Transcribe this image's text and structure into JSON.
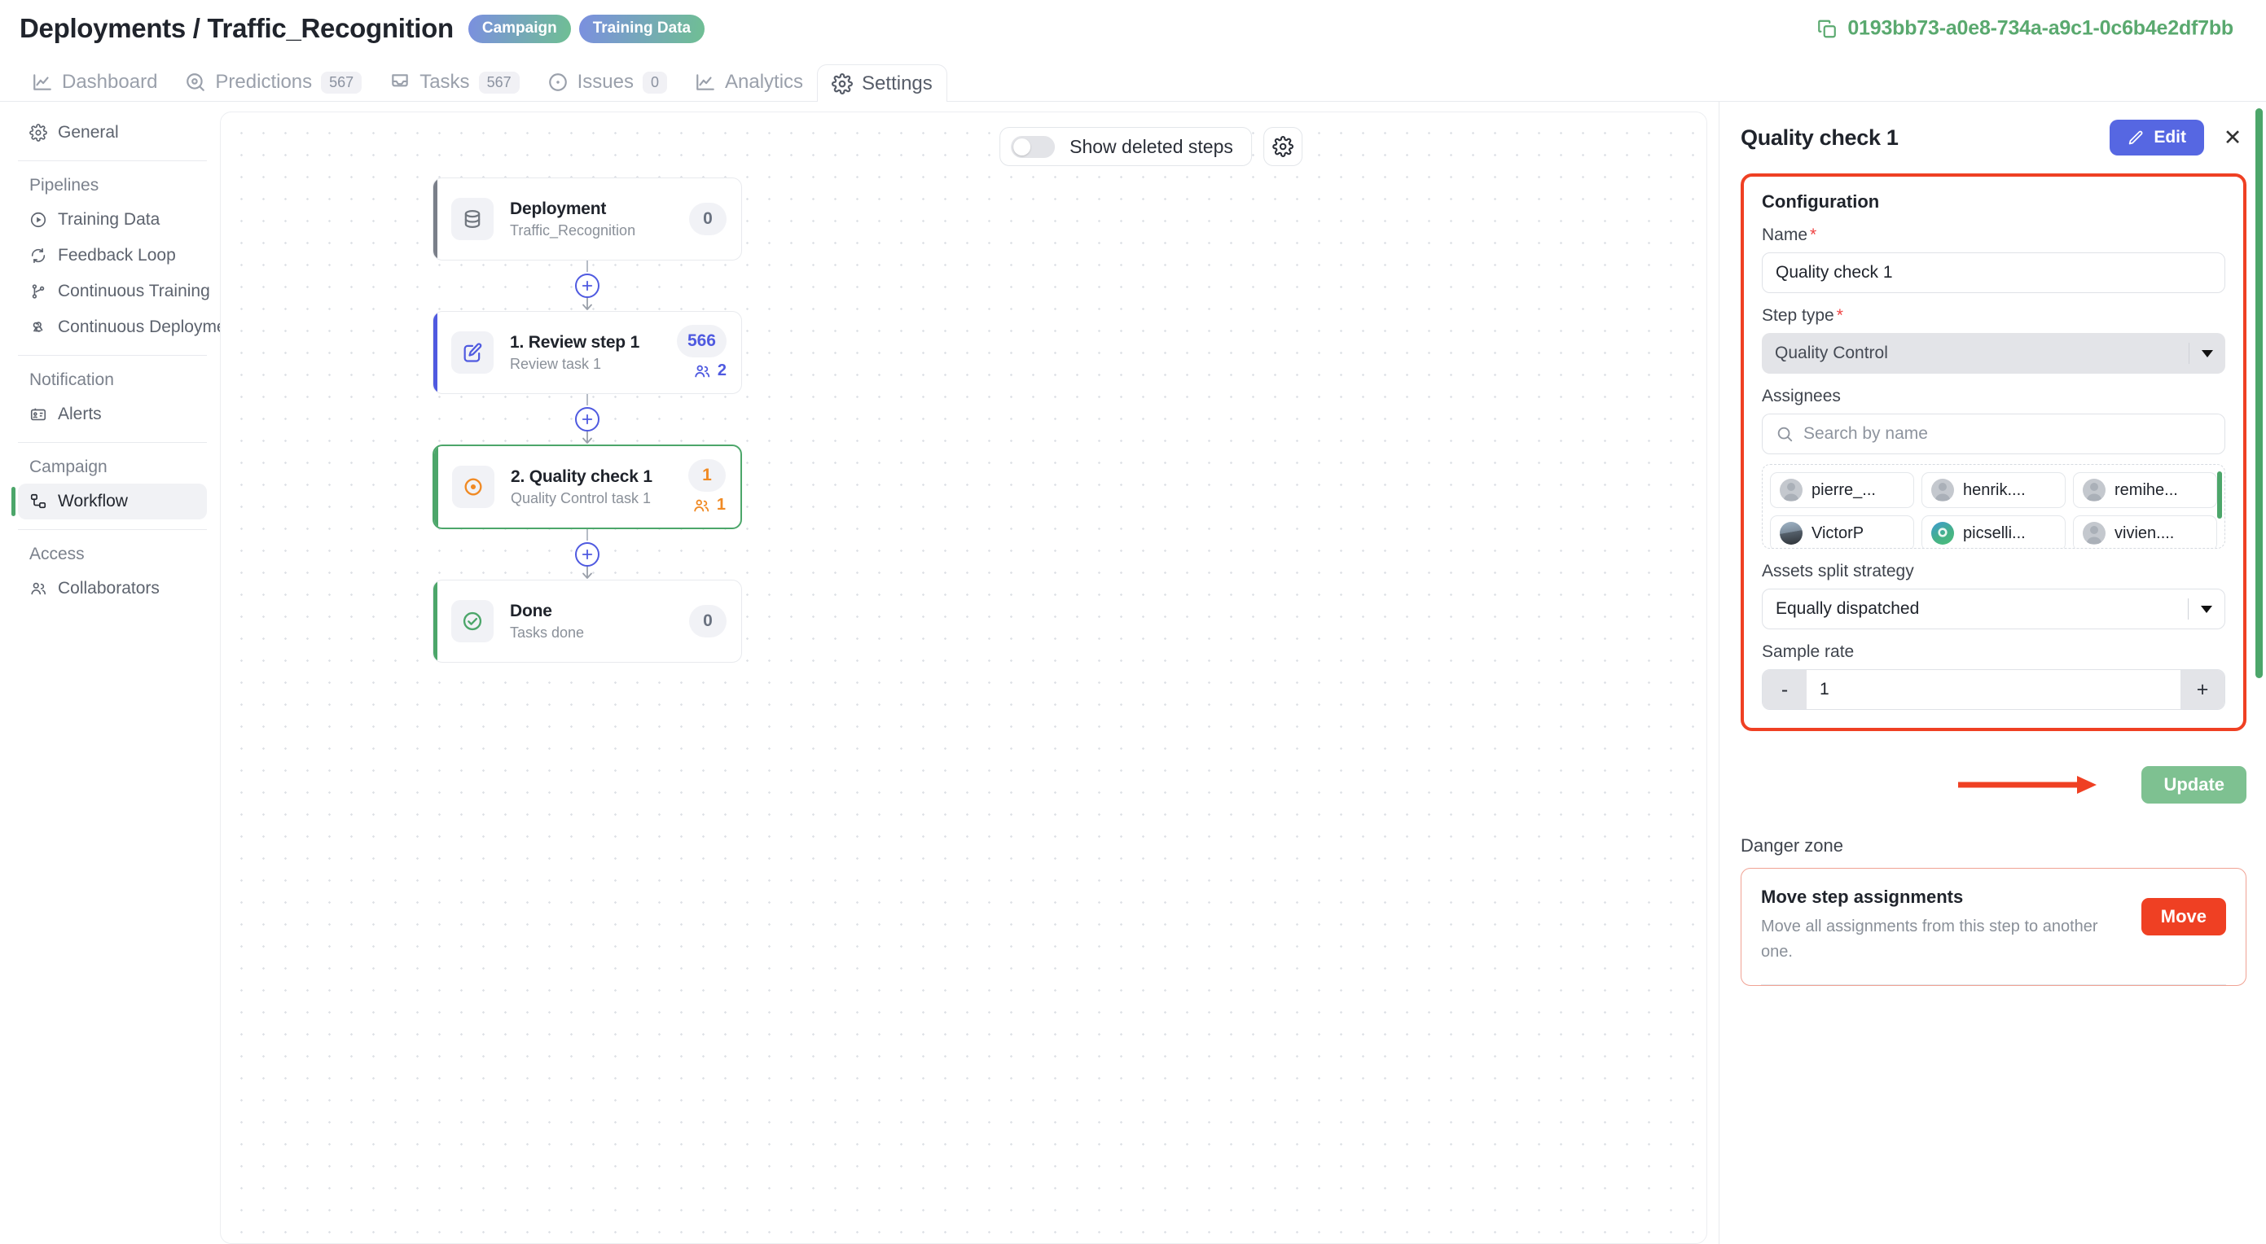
{
  "header": {
    "breadcrumb": "Deployments / Traffic_Recognition",
    "badges": [
      "Campaign",
      "Training Data"
    ],
    "deployment_id": "0193bb73-a0e8-734a-a9c1-0c6b4e2df7bb",
    "copy_icon": "copy-icon"
  },
  "tabs": [
    {
      "label": "Dashboard",
      "icon": "chart-line-icon",
      "count": null,
      "active": false
    },
    {
      "label": "Predictions",
      "icon": "target-icon",
      "count": "567",
      "active": false
    },
    {
      "label": "Tasks",
      "icon": "inbox-icon",
      "count": "567",
      "active": false
    },
    {
      "label": "Issues",
      "icon": "alert-circle-icon",
      "count": "0",
      "active": false
    },
    {
      "label": "Analytics",
      "icon": "chart-line-icon",
      "count": null,
      "active": false
    },
    {
      "label": "Settings",
      "icon": "gear-icon",
      "count": null,
      "active": true
    }
  ],
  "sidebar": [
    {
      "type": "item",
      "label": "General",
      "icon": "gear-icon",
      "active": false
    },
    {
      "type": "sep"
    },
    {
      "type": "group",
      "label": "Pipelines"
    },
    {
      "type": "item",
      "label": "Training Data",
      "icon": "play-circle-icon",
      "active": false
    },
    {
      "type": "item",
      "label": "Feedback Loop",
      "icon": "refresh-icon",
      "active": false
    },
    {
      "type": "item",
      "label": "Continuous Training",
      "icon": "git-branch-icon",
      "active": false
    },
    {
      "type": "item",
      "label": "Continuous Deployment",
      "icon": "webhook-icon",
      "active": false
    },
    {
      "type": "sep"
    },
    {
      "type": "group",
      "label": "Notification"
    },
    {
      "type": "item",
      "label": "Alerts",
      "icon": "id-card-icon",
      "active": false
    },
    {
      "type": "sep"
    },
    {
      "type": "group",
      "label": "Campaign"
    },
    {
      "type": "item",
      "label": "Workflow",
      "icon": "workflow-icon",
      "active": true
    },
    {
      "type": "sep"
    },
    {
      "type": "group",
      "label": "Access"
    },
    {
      "type": "item",
      "label": "Collaborators",
      "icon": "users-icon",
      "active": false
    }
  ],
  "canvas": {
    "toggle_label": "Show deleted steps",
    "toggle_on": false,
    "settings_icon": "gear-icon",
    "steps": [
      {
        "title": "Deployment",
        "subtitle": "Traffic_Recognition",
        "icon": "database-icon",
        "count": "0",
        "count_color": "gray",
        "assignees": null,
        "accent": "#7a7f89",
        "selected": false
      },
      {
        "title": "1. Review step 1",
        "subtitle": "Review task 1",
        "icon": "edit-square-icon",
        "count": "566",
        "count_color": "blue",
        "assignees": "2",
        "accent": "#4f5ae0",
        "selected": false
      },
      {
        "title": "2. Quality check 1",
        "subtitle": "Quality Control task 1",
        "icon": "eye-target-icon",
        "count": "1",
        "count_color": "orange",
        "assignees": "1",
        "accent": "#4ca66a",
        "selected": true
      },
      {
        "title": "Done",
        "subtitle": "Tasks done",
        "icon": "check-circle-icon",
        "count": "0",
        "count_color": "gray",
        "assignees": null,
        "accent": "#4ca66a",
        "selected": false
      }
    ],
    "add_step_icon": "plus-icon"
  },
  "panel": {
    "title": "Quality check 1",
    "edit_label": "Edit",
    "edit_icon": "pencil-icon",
    "close_icon": "close-icon",
    "section_title": "Configuration",
    "name_label": "Name",
    "name_value": "Quality check 1",
    "step_type_label": "Step type",
    "step_type_value": "Quality Control",
    "assignees_label": "Assignees",
    "assignees_search_placeholder": "Search by name",
    "assignees": [
      {
        "name": "pierre_...",
        "avatar": "placeholder"
      },
      {
        "name": "henrik....",
        "avatar": "placeholder"
      },
      {
        "name": "remihe...",
        "avatar": "placeholder"
      },
      {
        "name": "VictorP",
        "avatar": "photo"
      },
      {
        "name": "picselli...",
        "avatar": "logo"
      },
      {
        "name": "vivien....",
        "avatar": "placeholder"
      }
    ],
    "split_label": "Assets split strategy",
    "split_value": "Equally dispatched",
    "sample_label": "Sample rate",
    "sample_value": "1",
    "sample_minus": "-",
    "sample_plus": "+",
    "update_label": "Update",
    "danger_title": "Danger zone",
    "danger_item_title": "Move step assignments",
    "danger_item_desc": "Move all assignments from this step to another one.",
    "danger_item_button": "Move"
  },
  "colors": {
    "accent_green": "#4ca66a",
    "accent_blue": "#4f5ae0",
    "accent_orange": "#f08a24",
    "highlight_red": "#ef4023",
    "update_green": "#7ec191",
    "edit_blue": "#5667e2"
  }
}
